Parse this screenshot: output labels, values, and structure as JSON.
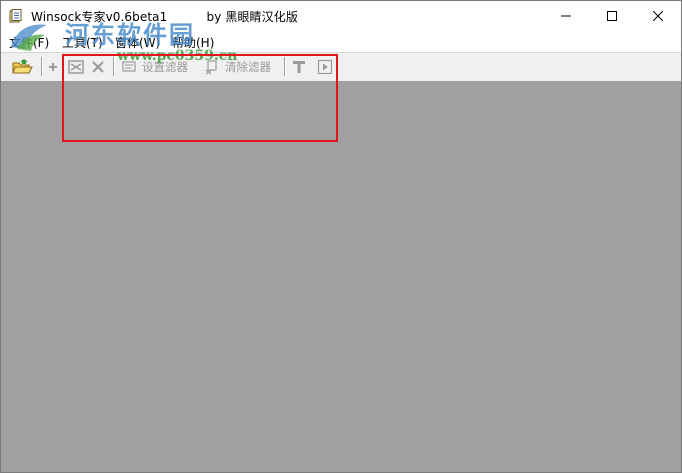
{
  "window": {
    "title": "Winsock专家v0.6beta1          by 黑眼睛汉化版",
    "controls": {
      "minimize_icon": "minimize-icon",
      "maximize_icon": "maximize-icon",
      "close_icon": "close-icon"
    }
  },
  "menu": {
    "items": [
      {
        "label": "文件(F)"
      },
      {
        "label": "工具(T)"
      },
      {
        "label": "窗体(W)"
      },
      {
        "label": "帮助(H)"
      }
    ]
  },
  "toolbar": {
    "set_filter_label": "设置滤器",
    "clear_filter_label": "清除滤器",
    "buttons": [
      "open-folder-icon",
      "add-icon",
      "capture-icon",
      "delete-icon",
      "set-filter-icon",
      "clear-filter-icon",
      "text-icon",
      "play-icon"
    ]
  },
  "watermark": {
    "title": "河东软件园",
    "url": "www.pc0359.cn"
  },
  "colors": {
    "client_background": "#a0a0a0",
    "highlight": "#e0161a",
    "watermark_blue": "#4d8fce",
    "watermark_green": "#3c9a3c"
  }
}
